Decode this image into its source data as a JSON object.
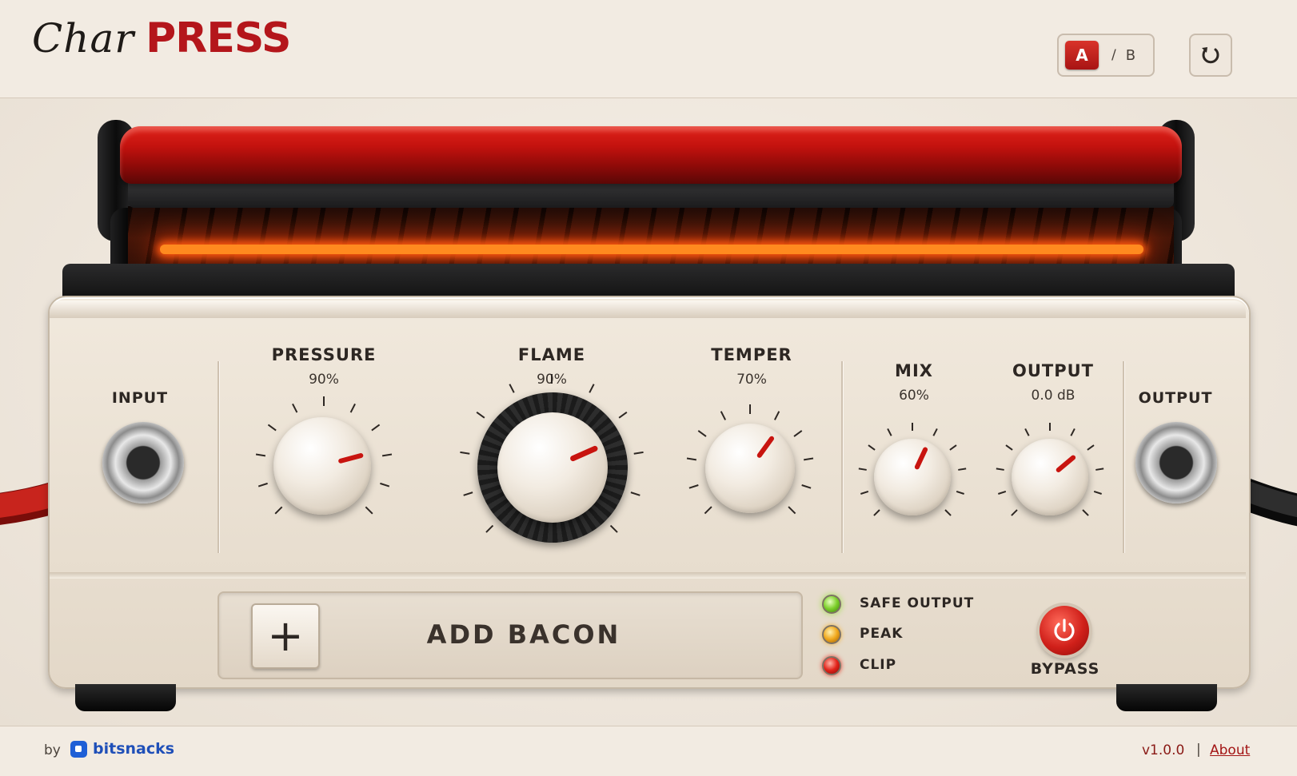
{
  "header": {
    "logo_script": "Char",
    "logo_bold": "PRESS",
    "ab_a": "A",
    "ab_separator": "/",
    "ab_b": "B",
    "reset_icon": "undo-icon"
  },
  "controls": {
    "input_label": "INPUT",
    "output_jack_label": "OUTPUT",
    "knobs": [
      {
        "label": "PRESSURE",
        "value": "90%"
      },
      {
        "label": "FLAME",
        "value": "90%"
      },
      {
        "label": "TEMPER",
        "value": "70%"
      },
      {
        "label": "MIX",
        "value": "60%"
      },
      {
        "label": "OUTPUT",
        "value": "0.0 dB"
      }
    ]
  },
  "bacon": {
    "plus_icon": "plus-icon",
    "label": "ADD BACON"
  },
  "leds": [
    {
      "label": "SAFE OUTPUT",
      "color": "#7ccf2a"
    },
    {
      "label": "PEAK",
      "color": "#f1a81c"
    },
    {
      "label": "CLIP",
      "color": "#e2231a"
    }
  ],
  "bypass": {
    "label": "BYPASS",
    "icon": "power-icon"
  },
  "footer": {
    "by": "by",
    "brand": "bitsnacks",
    "version": "v1.0.0",
    "separator": "|",
    "about": "About"
  },
  "colors": {
    "accent_red": "#b4161b",
    "brand_blue": "#1f5fd6",
    "panel_cream": "#f1e9dd"
  }
}
